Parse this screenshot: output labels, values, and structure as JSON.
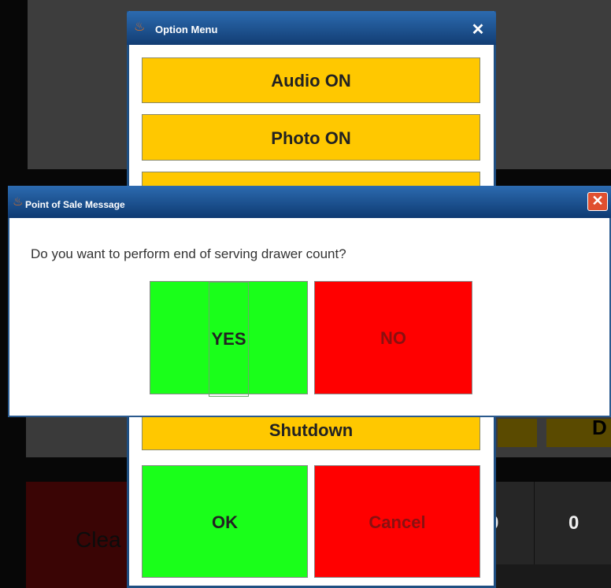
{
  "background": {
    "right_label": "D",
    "clear_label": "Clea",
    "key1_label": "0",
    "key2_label": "0"
  },
  "option_menu": {
    "title": "Option Menu",
    "close": "✕",
    "buttons": [
      "Audio ON",
      "Photo ON",
      "",
      "Shutdown"
    ],
    "ok": "OK",
    "cancel": "Cancel"
  },
  "message_dialog": {
    "title": "Point of Sale Message",
    "close": "✕",
    "message": "Do you want to perform end of serving drawer count?",
    "yes": "YES",
    "no": "NO"
  },
  "colors": {
    "yellow": "#ffc800",
    "green": "#1aff1a",
    "red": "#ff0000",
    "title_blue": "#1f4f82"
  }
}
